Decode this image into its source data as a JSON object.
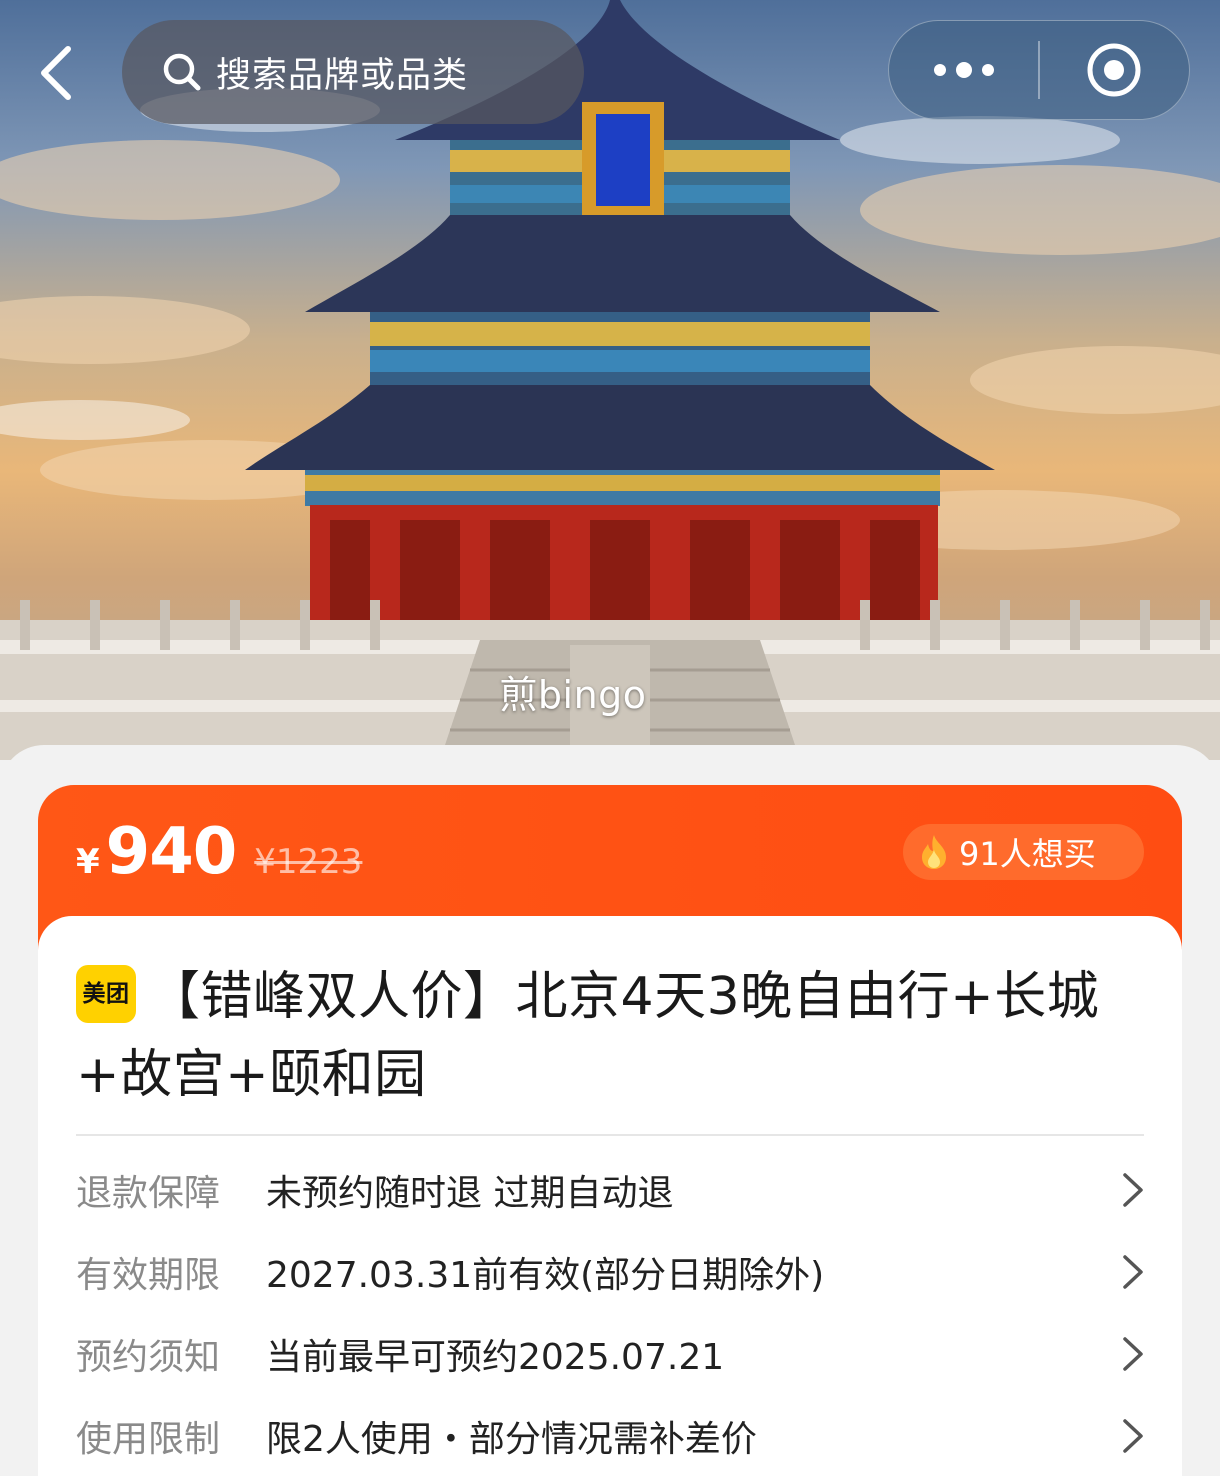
{
  "header": {
    "search_placeholder": "搜索品牌或品类"
  },
  "hero": {
    "caption": "煎bingo"
  },
  "price": {
    "currency_symbol": "¥",
    "current": "940",
    "original": "¥1223",
    "want_count_text": "91人想买"
  },
  "product": {
    "brand_badge": "美团",
    "title": "【错峰双人价】北京4天3晚自由行+长城+故宫+颐和园"
  },
  "details": [
    {
      "label": "退款保障",
      "value": "未预约随时退 过期自动退"
    },
    {
      "label": "有效期限",
      "value": "2027.03.31前有效(部分日期除外)"
    },
    {
      "label": "预约须知",
      "value": "当前最早可预约2025.07.21"
    },
    {
      "label": "使用限制",
      "value": "限2人使用・部分情况需补差价"
    }
  ],
  "colors": {
    "accent": "#ff5716",
    "brand_badge": "#ffd100"
  }
}
